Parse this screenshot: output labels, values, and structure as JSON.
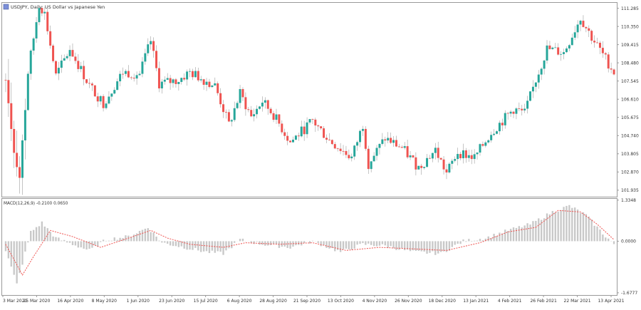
{
  "window_title": "USDJPY, Daily: US Dollar vs Japanese Yen",
  "indicator_label": "MACD(12,26,9) -0.2100 0.0650",
  "colors": {
    "bull": "#26a69a",
    "bear": "#ef5350",
    "macd_hist": "#c8c8c8",
    "signal": "#ef5350",
    "frame": "#9a9a9a",
    "text": "#333333"
  },
  "chart_data": [
    {
      "type": "candlestick",
      "title": "USDJPY, Daily: US Dollar vs Japanese Yen",
      "y_ticks": [
        "111.285",
        "110.350",
        "109.415",
        "108.480",
        "107.545",
        "106.610",
        "105.675",
        "104.740",
        "103.805",
        "102.870",
        "101.935"
      ],
      "ylim": [
        101.6,
        111.6
      ],
      "price_path_anchors": [
        {
          "i": 0,
          "price": 107.6
        },
        {
          "i": 3,
          "price": 104.0
        },
        {
          "i": 5,
          "price": 102.6
        },
        {
          "i": 8,
          "price": 108.0
        },
        {
          "i": 12,
          "price": 111.5
        },
        {
          "i": 14,
          "price": 111.0
        },
        {
          "i": 18,
          "price": 107.8
        },
        {
          "i": 23,
          "price": 109.2
        },
        {
          "i": 30,
          "price": 107.3
        },
        {
          "i": 35,
          "price": 106.4
        },
        {
          "i": 42,
          "price": 108.0
        },
        {
          "i": 48,
          "price": 107.9
        },
        {
          "i": 52,
          "price": 109.6
        },
        {
          "i": 55,
          "price": 107.4
        },
        {
          "i": 62,
          "price": 107.6
        },
        {
          "i": 66,
          "price": 108.0
        },
        {
          "i": 75,
          "price": 107.3
        },
        {
          "i": 80,
          "price": 105.3
        },
        {
          "i": 84,
          "price": 106.9
        },
        {
          "i": 88,
          "price": 105.7
        },
        {
          "i": 92,
          "price": 106.5
        },
        {
          "i": 96,
          "price": 105.8
        },
        {
          "i": 102,
          "price": 104.4
        },
        {
          "i": 110,
          "price": 105.5
        },
        {
          "i": 116,
          "price": 104.5
        },
        {
          "i": 124,
          "price": 103.6
        },
        {
          "i": 128,
          "price": 105.3
        },
        {
          "i": 130,
          "price": 103.3
        },
        {
          "i": 136,
          "price": 104.6
        },
        {
          "i": 142,
          "price": 104.1
        },
        {
          "i": 148,
          "price": 103.1
        },
        {
          "i": 154,
          "price": 104.0
        },
        {
          "i": 158,
          "price": 102.8
        },
        {
          "i": 162,
          "price": 103.9
        },
        {
          "i": 168,
          "price": 103.6
        },
        {
          "i": 174,
          "price": 104.9
        },
        {
          "i": 178,
          "price": 105.5
        },
        {
          "i": 182,
          "price": 106.1
        },
        {
          "i": 186,
          "price": 105.9
        },
        {
          "i": 190,
          "price": 107.6
        },
        {
          "i": 194,
          "price": 109.2
        },
        {
          "i": 200,
          "price": 109.0
        },
        {
          "i": 206,
          "price": 110.8
        },
        {
          "i": 210,
          "price": 109.8
        },
        {
          "i": 214,
          "price": 108.9
        },
        {
          "i": 218,
          "price": 108.0
        }
      ],
      "bars": 219
    },
    {
      "type": "macd",
      "label": "MACD(12,26,9) -0.2100 0.0650",
      "y_ticks": [
        "1.3348",
        "0.0000",
        "-1.6777"
      ],
      "ylim": [
        -1.75,
        1.4
      ],
      "signal_anchors": [
        {
          "i": 0,
          "v": -0.1
        },
        {
          "i": 6,
          "v": -1.1
        },
        {
          "i": 10,
          "v": -0.5
        },
        {
          "i": 16,
          "v": 0.35
        },
        {
          "i": 24,
          "v": 0.15
        },
        {
          "i": 34,
          "v": -0.2
        },
        {
          "i": 44,
          "v": 0.1
        },
        {
          "i": 52,
          "v": 0.35
        },
        {
          "i": 58,
          "v": 0.1
        },
        {
          "i": 66,
          "v": -0.1
        },
        {
          "i": 78,
          "v": -0.2
        },
        {
          "i": 86,
          "v": -0.05
        },
        {
          "i": 98,
          "v": -0.1
        },
        {
          "i": 110,
          "v": -0.05
        },
        {
          "i": 122,
          "v": -0.3
        },
        {
          "i": 134,
          "v": -0.2
        },
        {
          "i": 146,
          "v": -0.25
        },
        {
          "i": 158,
          "v": -0.3
        },
        {
          "i": 170,
          "v": -0.05
        },
        {
          "i": 180,
          "v": 0.3
        },
        {
          "i": 190,
          "v": 0.45
        },
        {
          "i": 198,
          "v": 1.0
        },
        {
          "i": 206,
          "v": 0.95
        },
        {
          "i": 212,
          "v": 0.55
        },
        {
          "i": 218,
          "v": 0.05
        }
      ],
      "histogram_anchors": [
        {
          "i": 0,
          "v": -0.3
        },
        {
          "i": 4,
          "v": -1.4
        },
        {
          "i": 9,
          "v": 0.3
        },
        {
          "i": 13,
          "v": 0.6
        },
        {
          "i": 18,
          "v": 0.1
        },
        {
          "i": 24,
          "v": -0.1
        },
        {
          "i": 30,
          "v": -0.3
        },
        {
          "i": 36,
          "v": 0.05
        },
        {
          "i": 44,
          "v": 0.15
        },
        {
          "i": 51,
          "v": 0.45
        },
        {
          "i": 56,
          "v": -0.05
        },
        {
          "i": 64,
          "v": -0.2
        },
        {
          "i": 72,
          "v": -0.35
        },
        {
          "i": 78,
          "v": -0.4
        },
        {
          "i": 84,
          "v": 0.05
        },
        {
          "i": 92,
          "v": -0.1
        },
        {
          "i": 102,
          "v": -0.2
        },
        {
          "i": 110,
          "v": 0.0
        },
        {
          "i": 120,
          "v": -0.35
        },
        {
          "i": 128,
          "v": -0.1
        },
        {
          "i": 136,
          "v": -0.15
        },
        {
          "i": 146,
          "v": -0.35
        },
        {
          "i": 156,
          "v": -0.4
        },
        {
          "i": 164,
          "v": 0.0
        },
        {
          "i": 172,
          "v": 0.1
        },
        {
          "i": 180,
          "v": 0.35
        },
        {
          "i": 188,
          "v": 0.55
        },
        {
          "i": 196,
          "v": 0.95
        },
        {
          "i": 202,
          "v": 1.15
        },
        {
          "i": 208,
          "v": 0.85
        },
        {
          "i": 214,
          "v": 0.25
        },
        {
          "i": 218,
          "v": -0.1
        }
      ]
    }
  ],
  "x_axis_labels": [
    "3 Mar 2020",
    "25 Mar 2020",
    "16 Apr 2020",
    "8 May 2020",
    "1 Jun 2020",
    "23 Jun 2020",
    "15 Jul 2020",
    "6 Aug 2020",
    "28 Aug 2020",
    "21 Sep 2020",
    "13 Oct 2020",
    "4 Nov 2020",
    "26 Nov 2020",
    "18 Dec 2020",
    "13 Jan 2021",
    "4 Feb 2021",
    "26 Feb 2021",
    "22 Mar 2021",
    "13 Apr 2021"
  ]
}
